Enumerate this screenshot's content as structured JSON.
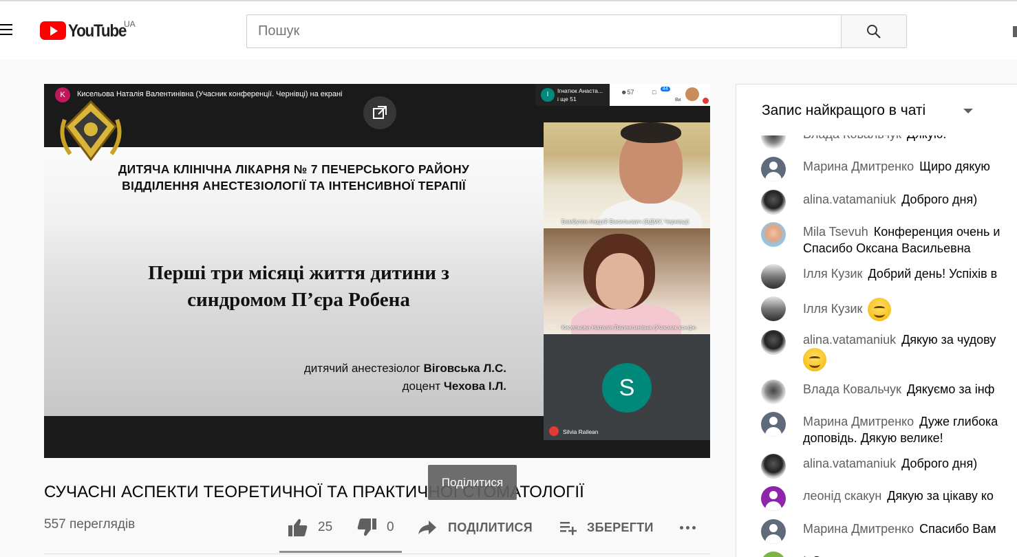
{
  "header": {
    "logo_text": "YouTube",
    "country": "UA",
    "search_placeholder": "Пошук"
  },
  "player": {
    "presenter_initial": "K",
    "presenter_text": "Кисельова Наталія Валентинівна (Учасник конференції. Чернівці) на екрані",
    "slide": {
      "hospital_line1": "ДИТЯЧА КЛІНІЧНА ЛІКАРНЯ № 7 ПЕЧЕРСЬКОГО РАЙОНУ",
      "hospital_line2": "ВІДДІЛЕННЯ АНЕСТЕЗІОЛОГІЇ ТА ІНТЕНСИВНОЇ ТЕРАПІЇ",
      "title_line1": "Перші три місяці життя дитини з",
      "title_line2": "синдромом П’єра Робена",
      "author1_role": "дитячий анестезіолог ",
      "author1_name": "Віговська Л.С.",
      "author2_role": "доцент ",
      "author2_name": "Чехова І.Л."
    },
    "meet_panel": {
      "active_initial": "І",
      "active_name": "Ігнатюк Анаста...",
      "active_more": "і ще 51",
      "people_count": "57",
      "chat_count": "44",
      "you_label": "Ви"
    },
    "tiles": [
      {
        "label": "Бамбуляк Андрій Васильович (БДМУ, Чернівці)"
      },
      {
        "label": "Кисельова Наталія Валентинівна (Учасник конфе"
      },
      {
        "initial": "S",
        "label": "Silvia Raileаn"
      }
    ]
  },
  "video": {
    "title": "СУЧАСНІ АСПЕКТИ ТЕОРЕТИЧНОЇ ТА ПРАКТИЧНОЇ СТОМАТОЛОГІЇ",
    "tooltip": "Поділитися",
    "views": "557 переглядів",
    "likes": "25",
    "dislikes": "0",
    "share_label": "ПОДІЛИТИСЯ",
    "save_label": "ЗБЕРЕГТИ"
  },
  "chat": {
    "header": "Запис найкращого в чаті",
    "messages": [
      {
        "author": "Влада Ковальчук",
        "text": "Дякую!"
      },
      {
        "author": "Марина Дмитренко",
        "text": "Щиро дякую"
      },
      {
        "author": "alina.vatamaniuk",
        "text": "Доброго дня)"
      },
      {
        "author": "Mila Tsevuh",
        "text": "Конференция очень и",
        "text2": "Спасибо Оксана Васильевна"
      },
      {
        "author": "Ілля Кузик",
        "text": "Добрий день! Успіхів в"
      },
      {
        "author": "Ілля Кузик",
        "text": ""
      },
      {
        "author": "alina.vatamaniuk",
        "text": "Дякую за чудову"
      },
      {
        "author": "Влада Ковальчук",
        "text": "Дякуємо за інф"
      },
      {
        "author": "Марина Дмитренко",
        "text": "Дуже глибока",
        "text2": "доповідь. Дякую велике!"
      },
      {
        "author": "alina.vatamaniuk",
        "text": "Доброго дня)"
      },
      {
        "author": "леонід скакун",
        "text": "Дякую за цікаву ко"
      },
      {
        "author": "Марина Дмитренко",
        "text": "Спасибо Вам"
      },
      {
        "author": "І",
        "text": "С"
      }
    ]
  }
}
